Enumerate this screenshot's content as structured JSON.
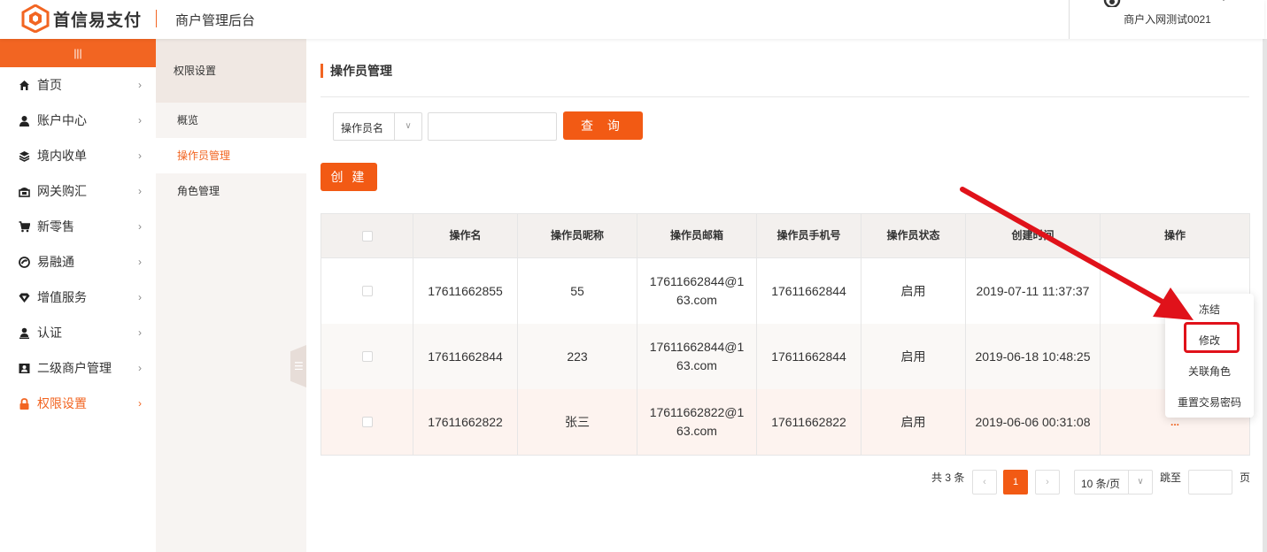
{
  "header": {
    "brand": "首信易支付",
    "system": "商户管理后台",
    "user_name": "商户入网测试0021"
  },
  "sidebar": {
    "collapse_glyph": "|||",
    "items": [
      {
        "label": "首页",
        "icon": "home-icon"
      },
      {
        "label": "账户中心",
        "icon": "user-icon"
      },
      {
        "label": "境内收单",
        "icon": "layers-icon"
      },
      {
        "label": "网关购汇",
        "icon": "bank-icon"
      },
      {
        "label": "新零售",
        "icon": "cart-icon"
      },
      {
        "label": "易融通",
        "icon": "finance-icon"
      },
      {
        "label": "增值服务",
        "icon": "diamond-icon"
      },
      {
        "label": "认证",
        "icon": "person-icon"
      },
      {
        "label": "二级商户管理",
        "icon": "id-card-icon"
      },
      {
        "label": "权限设置",
        "icon": "lock-icon",
        "active": true
      }
    ]
  },
  "subnav": {
    "title": "权限设置",
    "items": [
      "概览",
      "操作员管理",
      "角色管理"
    ],
    "active": "操作员管理"
  },
  "main": {
    "title": "操作员管理",
    "filter": {
      "select_value": "操作员名",
      "input_value": "",
      "query_label": "查 询"
    },
    "create_label": "创 建",
    "table": {
      "columns": [
        "操作名",
        "操作员昵称",
        "操作员邮箱",
        "操作员手机号",
        "操作员状态",
        "创建时间",
        "操作"
      ],
      "rows": [
        {
          "name": "17611662855",
          "nick": "55",
          "email": "17611662844@163.com",
          "phone": "17611662844",
          "status": "启用",
          "created": "2019-07-11 11:37:37",
          "ops": ""
        },
        {
          "name": "17611662844",
          "nick": "223",
          "email": "17611662844@163.com",
          "phone": "17611662844",
          "status": "启用",
          "created": "2019-06-18 10:48:25",
          "ops": ""
        },
        {
          "name": "17611662822",
          "nick": "张三",
          "email": "17611662822@163.com",
          "phone": "17611662822",
          "status": "启用",
          "created": "2019-06-06 00:31:08",
          "ops": "..."
        }
      ]
    },
    "pager": {
      "total": "共 3 条",
      "prev": "‹",
      "current": "1",
      "next": "›",
      "page_size": "10 条/页",
      "jump_label": "跳至",
      "page_suffix": "页"
    }
  },
  "popup": {
    "items": [
      "冻结",
      "修改",
      "关联角色",
      "重置交易密码"
    ],
    "highlighted": "修改"
  },
  "colors": {
    "accent": "#f26522",
    "highlight": "#e0121a"
  }
}
